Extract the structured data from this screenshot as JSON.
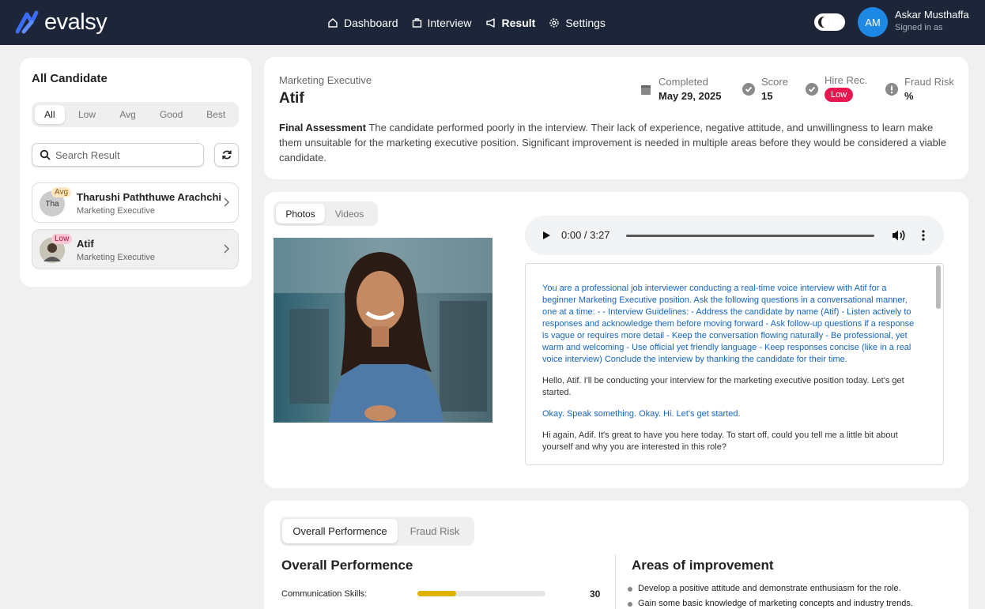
{
  "nav": {
    "logo": "evalsy",
    "links": [
      {
        "label": "Dashboard",
        "icon": "home-icon"
      },
      {
        "label": "Interview",
        "icon": "briefcase-icon"
      },
      {
        "label": "Result",
        "icon": "megaphone-icon",
        "active": true
      },
      {
        "label": "Settings",
        "icon": "gear-icon"
      }
    ],
    "user": {
      "initials": "AM",
      "name": "Askar Musthaffa",
      "status": "Signed in as"
    }
  },
  "sidebar": {
    "title": "All Candidate",
    "filters": [
      "All",
      "Low",
      "Avg",
      "Good",
      "Best"
    ],
    "selected_filter": "All",
    "search_placeholder": "Search Result",
    "candidates": [
      {
        "avatar": "Tha",
        "badge": "Avg",
        "name": "Tharushi Paththuwe Arachchi",
        "role": "Marketing Executive"
      },
      {
        "avatar": "",
        "badge": "Low",
        "name": "Atif",
        "role": "Marketing Executive"
      }
    ]
  },
  "summary": {
    "role": "Marketing Executive",
    "name": "Atif",
    "completed_label": "Completed",
    "completed_value": "May 29, 2025",
    "score_label": "Score",
    "score_value": "15",
    "hire_label": "Hire Rec.",
    "hire_value": "Low",
    "fraud_label": "Fraud Risk",
    "fraud_value": "%",
    "assessment_label": "Final Assessment",
    "assessment_text": "The candidate performed poorly in the interview. Their lack of experience, negative attitude, and unwillingness to learn make them unsuitable for the marketing executive position. Significant improvement is needed in multiple areas before they would be considered a viable candidate."
  },
  "media": {
    "tabs": [
      "Photos",
      "Videos"
    ],
    "audio_time": "0:00 / 3:27",
    "transcript": [
      {
        "speaker": "system",
        "text": "You are a professional job interviewer conducting a real-time voice interview with Atif for a beginner Marketing Executive position. Ask the following questions in a conversational manner, one at a time: - - Interview Guidelines: - Address the candidate by name (Atif) - Listen actively to responses and acknowledge them before moving forward - Ask follow-up questions if a response is vague or requires more detail - Keep the conversation flowing naturally - Be professional, yet warm and welcoming - Use official yet friendly language - Keep responses concise (like in a real voice interview) Conclude the interview by thanking the candidate for their time."
      },
      {
        "speaker": "interviewer",
        "text": "Hello, Atif. I'll be conducting your interview for the marketing executive position today. Let's get started."
      },
      {
        "speaker": "candidate",
        "text": "Okay. Speak something. Okay. Hi. Let's get started."
      },
      {
        "speaker": "interviewer",
        "text": "Hi again, Adif. It's great to have you here today. To start off, could you tell me a little bit about yourself and why you are interested in this role?"
      }
    ]
  },
  "performance": {
    "tabs": [
      "Overall Performence",
      "Fraud Risk"
    ],
    "overall_title": "Overall Performence",
    "metrics": [
      {
        "label": "Communication Skills:",
        "value": 30
      }
    ],
    "improve_title": "Areas of improvement",
    "improvements": [
      "Develop a positive attitude and demonstrate enthusiasm for the role.",
      "Gain some basic knowledge of marketing concepts and industry trends."
    ]
  }
}
